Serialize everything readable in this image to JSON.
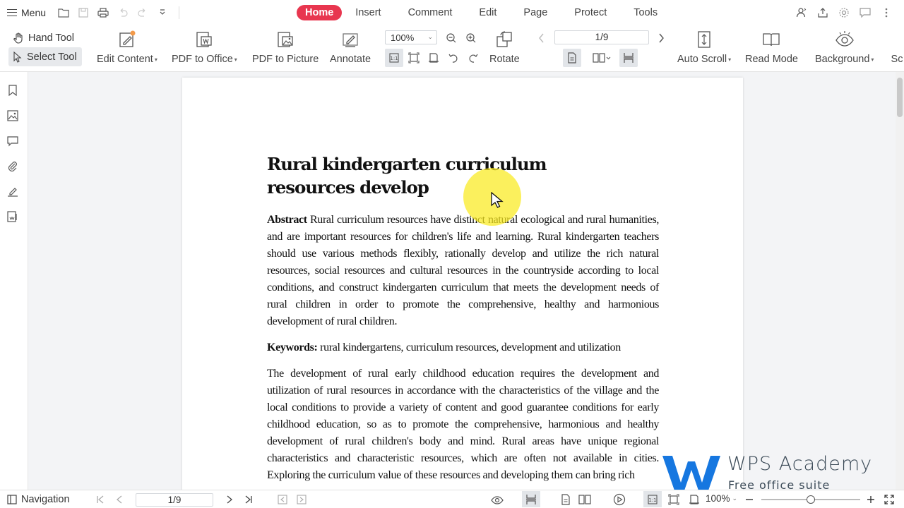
{
  "topbar": {
    "menu_label": "Menu",
    "tabs": [
      {
        "label": "Home",
        "active": true
      },
      {
        "label": "Insert"
      },
      {
        "label": "Comment"
      },
      {
        "label": "Edit"
      },
      {
        "label": "Page"
      },
      {
        "label": "Protect"
      },
      {
        "label": "Tools"
      }
    ],
    "accent_color": "#e8364f"
  },
  "ribbon": {
    "hand_tool": "Hand Tool",
    "select_tool": "Select Tool",
    "edit_content": "Edit Content",
    "pdf_to_office": "PDF to Office",
    "pdf_to_picture": "PDF to Picture",
    "annotate": "Annotate",
    "zoom_value": "100%",
    "rotate": "Rotate",
    "page_value": "1/9",
    "auto_scroll": "Auto Scroll",
    "read_mode": "Read Mode",
    "background": "Background",
    "cut_off": "Sc"
  },
  "document": {
    "title": "Rural kindergarten curriculum resources develop",
    "abstract_label": "Abstract",
    "abstract_text": "Rural curriculum resources have distinct natural ecological and rural humanities, and are important resources for children's life and learning. Rural kindergarten teachers should use various methods flexibly, rationally develop and utilize the rich natural resources, social resources and cultural resources in the countryside according to local conditions, and construct kindergarten curriculum that meets the development needs of rural children in order to promote the comprehensive, healthy and harmonious development of rural children.",
    "keywords_label": "Keywords:",
    "keywords_text": "rural kindergartens, curriculum resources, development and utilization",
    "body_text": "The development of rural early childhood education requires the development and utilization of rural resources in accordance with the characteristics of the village and the local conditions to provide a variety of content and good guarantee conditions for early childhood education, so as to promote the comprehensive, harmonious and healthy development of rural children's body and mind. Rural areas have unique regional characteristics and characteristic resources, which are often not available in cities. Exploring the curriculum value of these resources and developing them can bring rich"
  },
  "watermark": {
    "title": "WPS Academy",
    "subtitle": "Free office suite tutorials"
  },
  "statusbar": {
    "navigation": "Navigation",
    "page_value": "1/9",
    "zoom_value": "100%",
    "zoom_level": 0.5
  }
}
